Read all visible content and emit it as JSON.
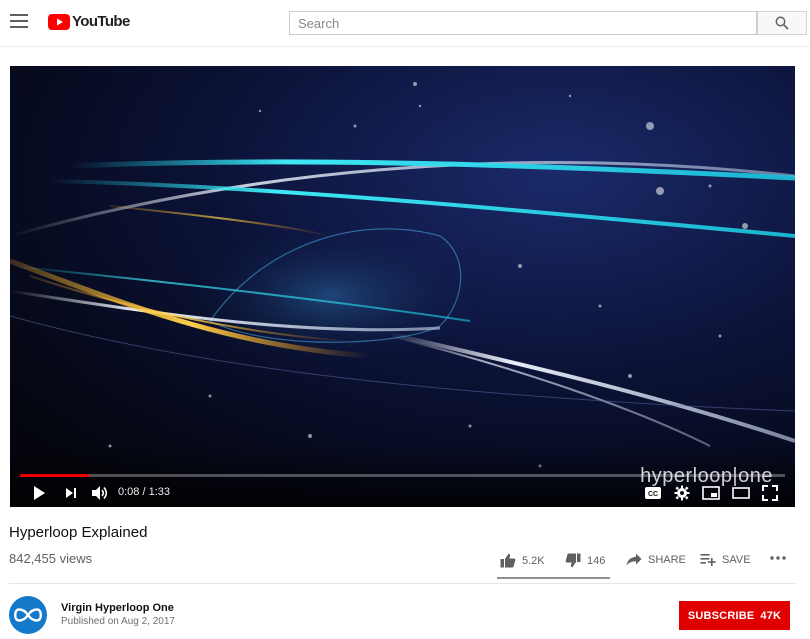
{
  "header": {
    "logo_text": "YouTube",
    "search_placeholder": "Search"
  },
  "player": {
    "watermark": "hyperloop|one",
    "time_display": "0:08 / 1:33",
    "progress_fraction": 0.09
  },
  "video": {
    "title": "Hyperloop Explained",
    "views": "842,455 views",
    "likes": "5.2K",
    "dislikes": "146",
    "share_label": "SHARE",
    "save_label": "SAVE"
  },
  "channel": {
    "name": "Virgin Hyperloop One",
    "published": "Published on Aug 2, 2017",
    "subscribe_label": "SUBSCRIBE",
    "subscriber_count": "47K"
  },
  "colors": {
    "accent": "#ff0000",
    "subscribe_bg": "#e00000",
    "avatar_bg": "#1479c9"
  }
}
